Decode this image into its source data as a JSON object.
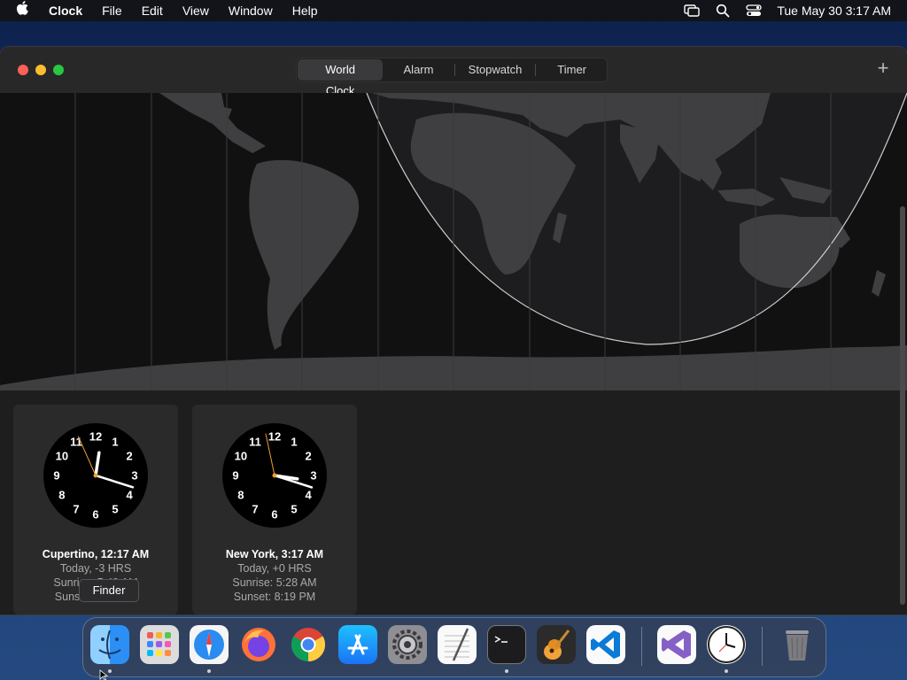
{
  "menubar": {
    "app_name": "Clock",
    "menus": [
      "File",
      "Edit",
      "View",
      "Window",
      "Help"
    ],
    "datetime": "Tue May 30  3:17 AM",
    "status_icons": [
      "screen-mirroring-icon",
      "search-icon",
      "control-center-icon"
    ]
  },
  "window": {
    "tabs": [
      {
        "label": "World Clock",
        "active": true
      },
      {
        "label": "Alarm",
        "active": false
      },
      {
        "label": "Stopwatch",
        "active": false
      },
      {
        "label": "Timer",
        "active": false
      }
    ],
    "add_label": "+"
  },
  "clocks": [
    {
      "city_line": "Cupertino, 12:17 AM",
      "offset": "Today, -3 HRS",
      "sunrise": "Sunrise: 5:49 AM",
      "sunset": "Sunset: 8:24 PM",
      "time": {
        "hour": 0,
        "minute": 17,
        "second": 56
      }
    },
    {
      "city_line": "New York, 3:17 AM",
      "offset": "Today, +0 HRS",
      "sunrise": "Sunrise: 5:28 AM",
      "sunset": "Sunset: 8:19 PM",
      "time": {
        "hour": 3,
        "minute": 17,
        "second": 58
      }
    }
  ],
  "tooltip": "Finder",
  "dock": [
    {
      "name": "finder",
      "running": true
    },
    {
      "name": "launchpad",
      "running": false
    },
    {
      "name": "safari",
      "running": true
    },
    {
      "name": "firefox",
      "running": false
    },
    {
      "name": "chrome",
      "running": false
    },
    {
      "name": "app-store",
      "running": false
    },
    {
      "name": "system-settings",
      "running": false
    },
    {
      "name": "textedit",
      "running": false
    },
    {
      "name": "terminal",
      "running": true
    },
    {
      "name": "garageband",
      "running": false
    },
    {
      "name": "vscode",
      "running": false
    },
    {
      "name": "visual-studio",
      "running": false
    },
    {
      "name": "clock",
      "running": true
    },
    {
      "name": "trash",
      "running": false
    }
  ],
  "colors": {
    "accent_hand": "#f0a030"
  }
}
